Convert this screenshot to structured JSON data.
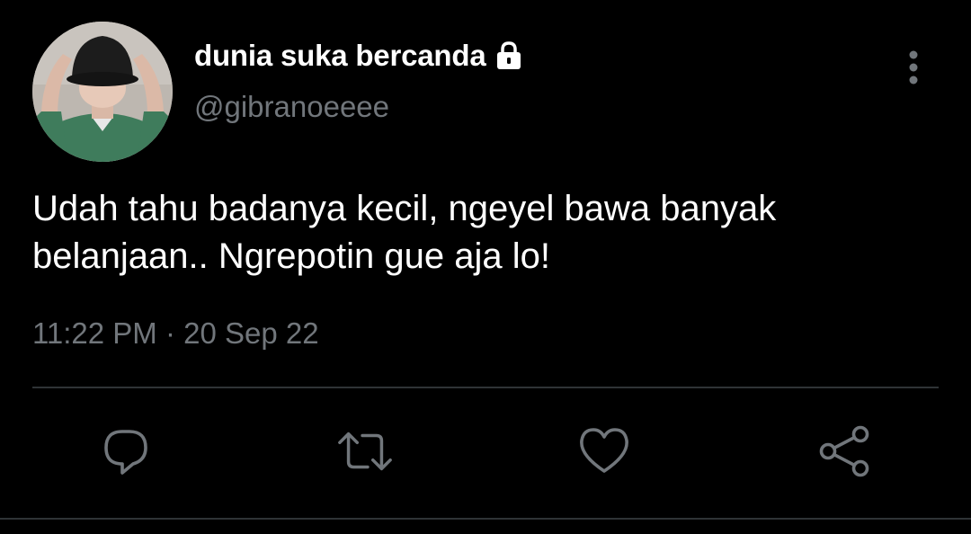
{
  "user": {
    "display_name": "dunia suka bercanda",
    "handle": "@gibranoeeee",
    "verified_icon": "lock-icon",
    "avatar_icon": "avatar"
  },
  "tweet": {
    "text_lines": [
      "Udah tahu badanya kecil, ngeyel bawa banyak",
      "belanjaan.. Ngrepotin gue aja lo!"
    ],
    "timestamp": "11:22 PM · 20 Sep 22"
  },
  "actions": [
    {
      "name": "reply",
      "icon": "reply-icon"
    },
    {
      "name": "retweet",
      "icon": "retweet-icon"
    },
    {
      "name": "like",
      "icon": "heart-icon"
    },
    {
      "name": "share",
      "icon": "share-icon"
    }
  ],
  "colors": {
    "background": "#000000",
    "text_primary": "#ffffff",
    "text_secondary": "#71767b",
    "divider": "#2f3336",
    "icon": "#71767b"
  }
}
